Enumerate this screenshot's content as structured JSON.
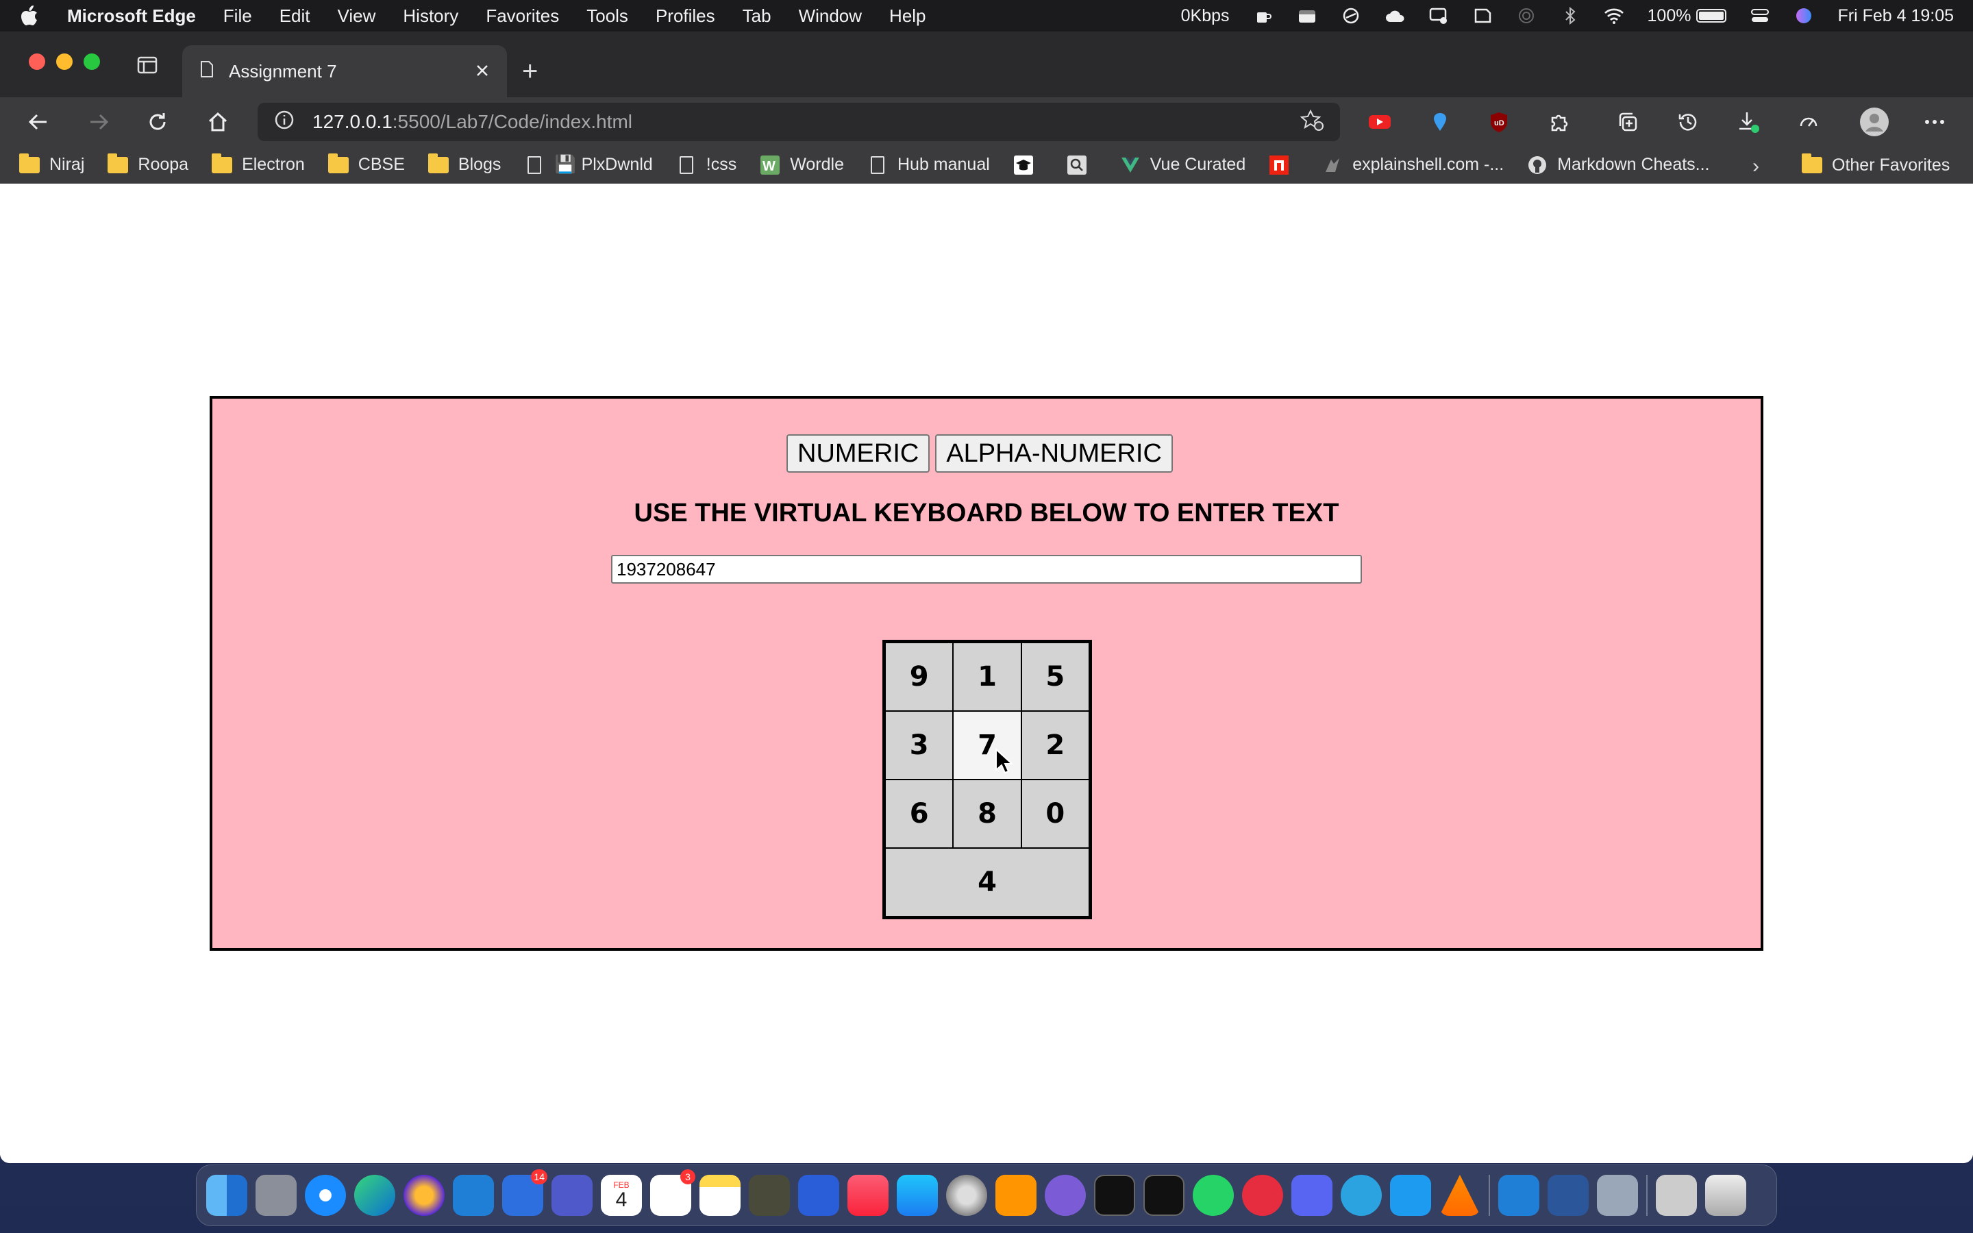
{
  "menubar": {
    "app_name": "Microsoft Edge",
    "items": [
      "File",
      "Edit",
      "View",
      "History",
      "Favorites",
      "Tools",
      "Profiles",
      "Tab",
      "Window",
      "Help"
    ],
    "network_speed": "0Kbps",
    "battery_percent": "100%",
    "datetime": "Fri Feb 4  19:05"
  },
  "browser": {
    "tab_title": "Assignment 7",
    "url_host": "127.0.0.1",
    "url_path": ":5500/Lab7/Code/index.html",
    "bookmarks": [
      {
        "label": "Niraj",
        "icon": "folder-icon"
      },
      {
        "label": "Roopa",
        "icon": "folder-icon"
      },
      {
        "label": "Electron",
        "icon": "folder-icon"
      },
      {
        "label": "CBSE",
        "icon": "folder-icon"
      },
      {
        "label": "Blogs",
        "icon": "folder-icon"
      },
      {
        "label": "PlxDwnld",
        "icon": "page-icon"
      },
      {
        "label": "!css",
        "icon": "page-icon"
      },
      {
        "label": "Wordle",
        "icon": "wordle-icon"
      },
      {
        "label": "Hub manual",
        "icon": "page-icon"
      },
      {
        "label": "",
        "icon": "graduation-icon"
      },
      {
        "label": "",
        "icon": "magnifier-icon"
      },
      {
        "label": "Vue Curated",
        "icon": "vue-icon"
      },
      {
        "label": "",
        "icon": "n-icon"
      },
      {
        "label": "explainshell.com -...",
        "icon": "shell-icon"
      },
      {
        "label": "Markdown Cheats...",
        "icon": "github-icon"
      }
    ],
    "other_favorites": "Other Favorites"
  },
  "page": {
    "mode_buttons": {
      "numeric": "NUMERIC",
      "alphanumeric": "ALPHA-NUMERIC"
    },
    "instruction": "USE THE VIRTUAL KEYBOARD BELOW TO ENTER TEXT",
    "input_value": "1937208647",
    "keys": [
      "9",
      "1",
      "5",
      "3",
      "7",
      "2",
      "6",
      "8",
      "0",
      "4"
    ],
    "hovered_key": "7"
  },
  "dock": {
    "calendar_month": "FEB",
    "calendar_day": "4",
    "badges": {
      "spark": "14",
      "reminders": "3"
    }
  },
  "colors": {
    "app_background": "#ffb6c1",
    "key_background": "#d3d3d3",
    "key_hover": "#f4f4f4"
  }
}
